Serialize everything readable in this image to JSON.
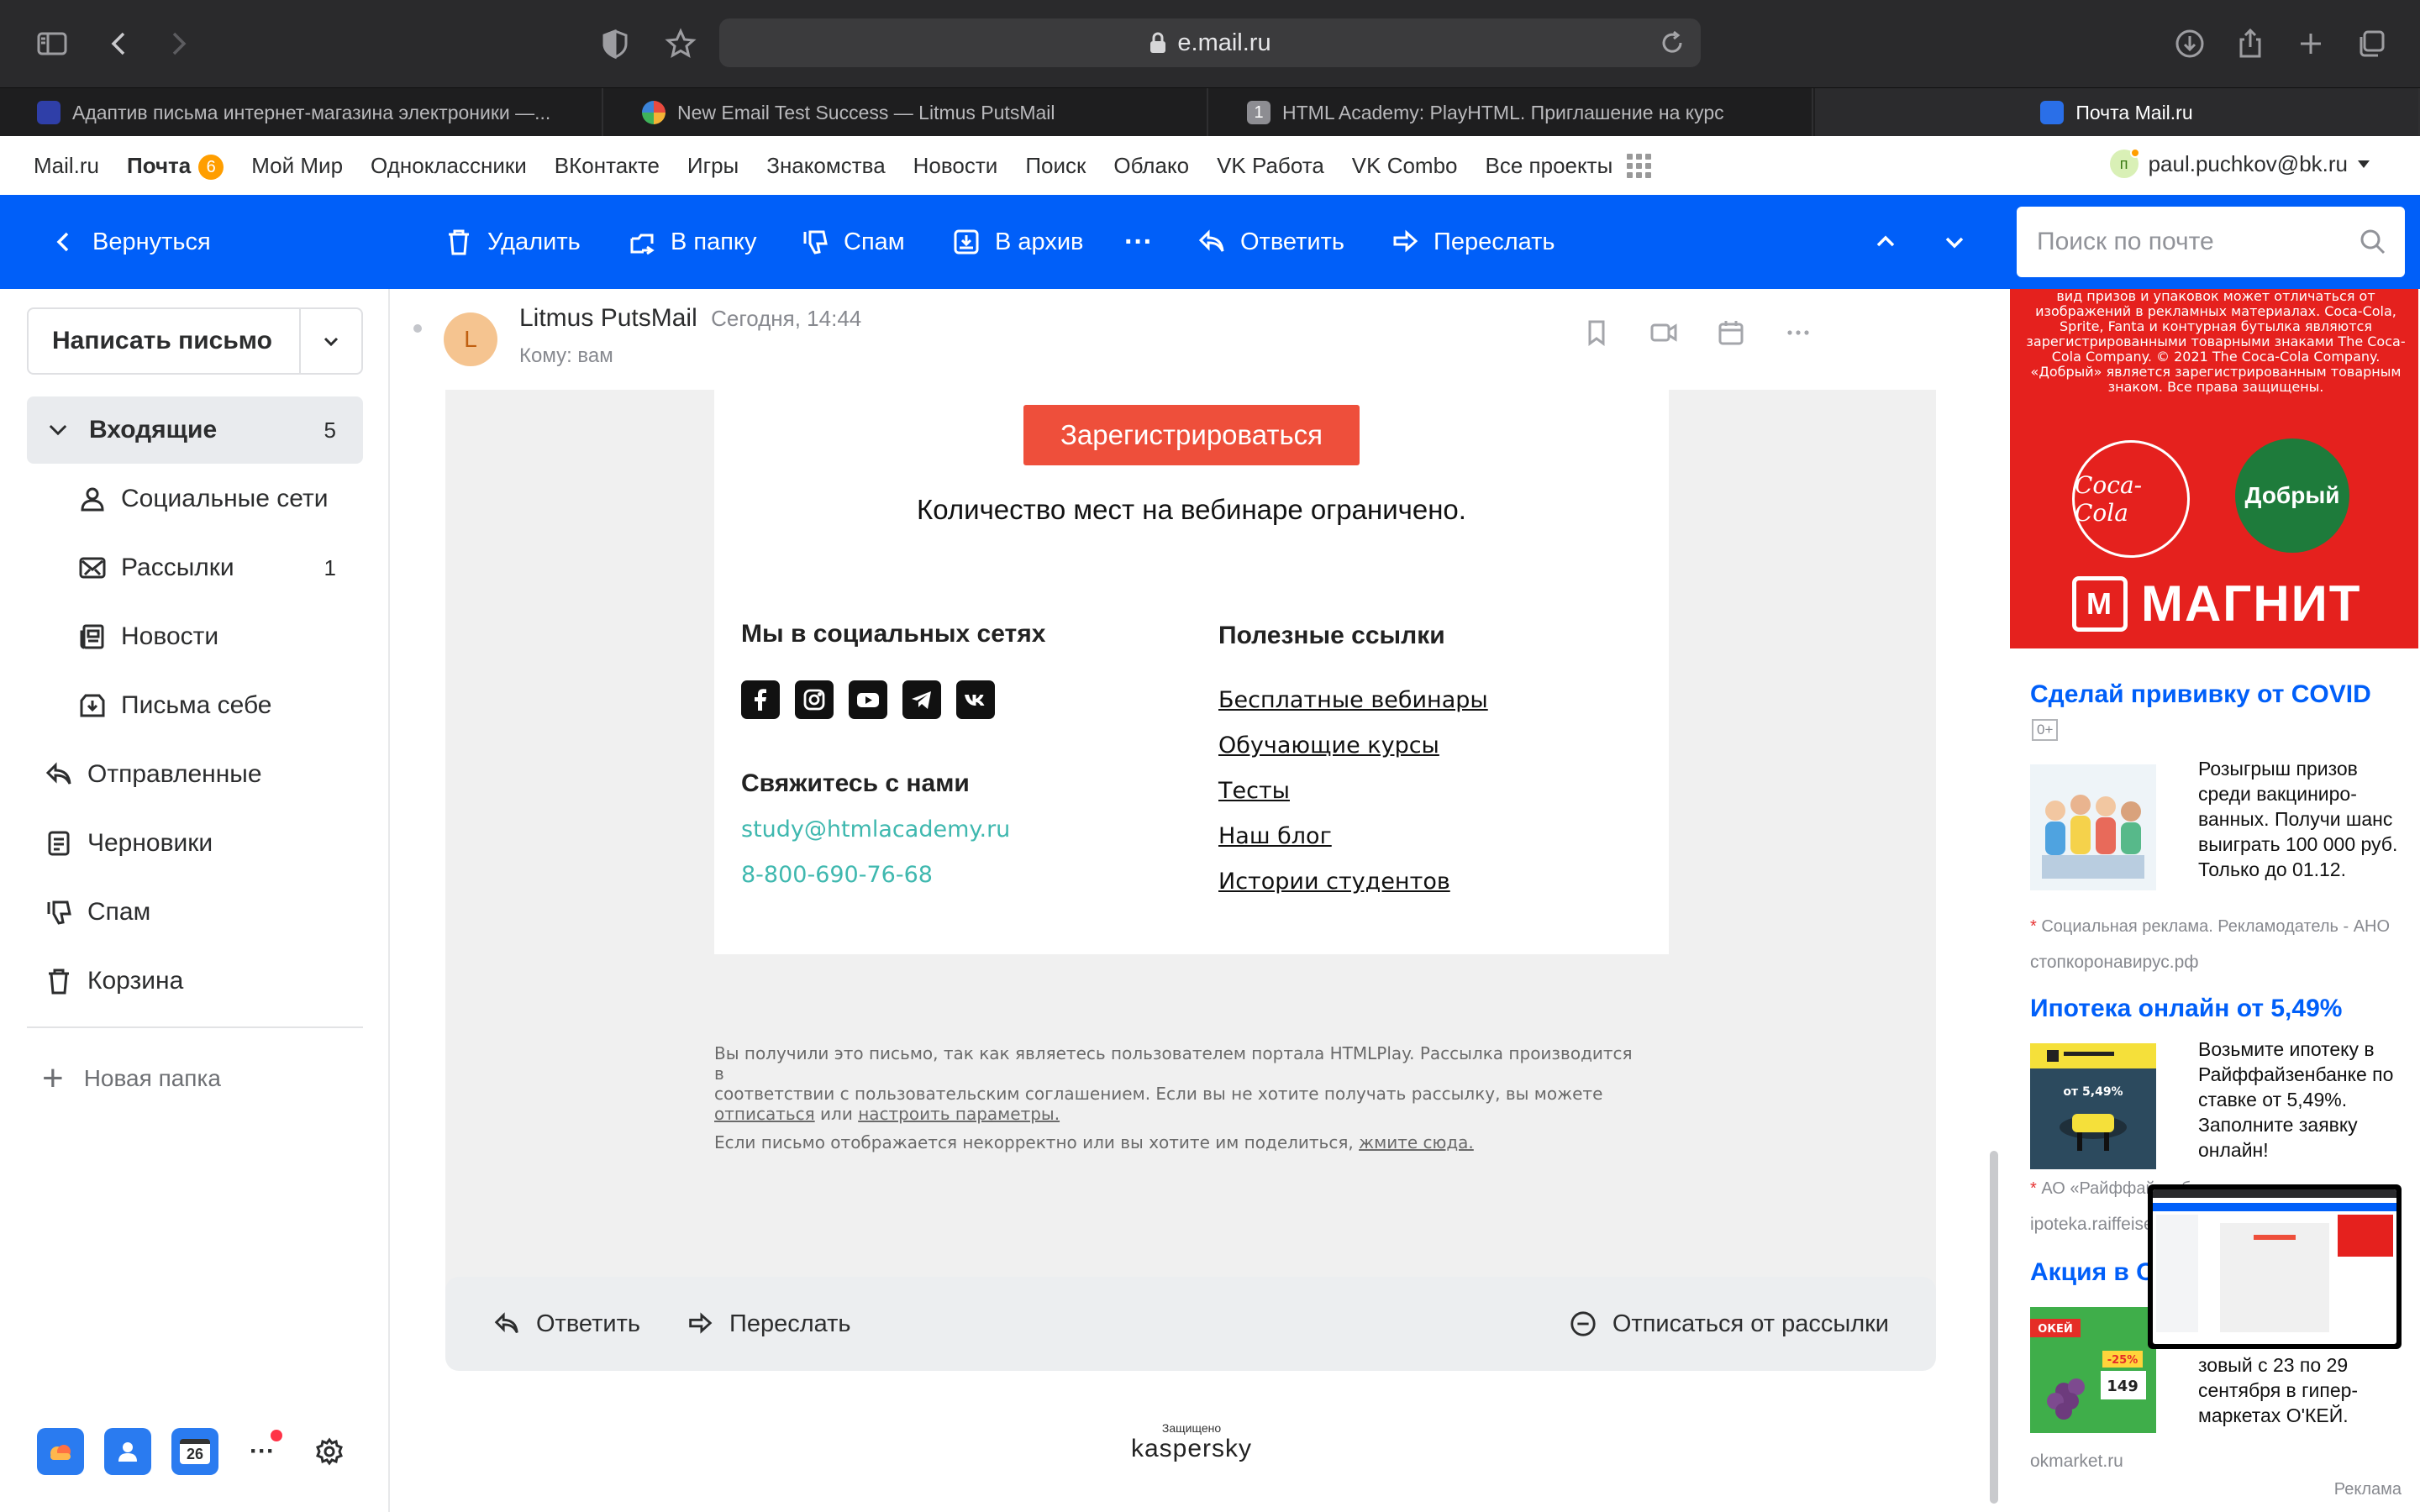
{
  "browser": {
    "url": "e.mail.ru",
    "tabs": [
      {
        "title": "Адаптив письма интернет-магазина электроники —..."
      },
      {
        "title": "New Email Test Success — Litmus PutsMail"
      },
      {
        "title": "HTML Academy: PlayHTML. Приглашение на курс",
        "favicon_text": "1"
      },
      {
        "title": "Почта Mail.ru"
      }
    ]
  },
  "portal": {
    "links": [
      "Mail.ru",
      "Почта",
      "Мой Мир",
      "Одноклассники",
      "ВКонтакте",
      "Игры",
      "Знакомства",
      "Новости",
      "Поиск",
      "Облако",
      "VK Работа",
      "VK Combo",
      "Все проекты"
    ],
    "mail_badge": "6",
    "user_initial": "п",
    "user_email": "paul.puchkov@bk.ru"
  },
  "toolbar": {
    "back": "Вернуться",
    "delete": "Удалить",
    "to_folder": "В папку",
    "spam": "Спам",
    "archive": "В архив",
    "more": "···",
    "reply": "Ответить",
    "forward": "Переслать",
    "search_placeholder": "Поиск по почте"
  },
  "sidebar": {
    "compose": "Написать письмо",
    "folders": [
      {
        "label": "Входящие",
        "count": "5"
      },
      {
        "label": "Социальные сети",
        "count": ""
      },
      {
        "label": "Рассылки",
        "count": "1"
      },
      {
        "label": "Новости",
        "count": ""
      },
      {
        "label": "Письма себе",
        "count": ""
      },
      {
        "label": "Отправленные",
        "count": ""
      },
      {
        "label": "Черновики",
        "count": ""
      },
      {
        "label": "Спам",
        "count": ""
      },
      {
        "label": "Корзина",
        "count": ""
      }
    ],
    "new_folder": "Новая папка",
    "calendar_day": "26",
    "more": "···"
  },
  "message": {
    "avatar_letter": "L",
    "sender": "Litmus PutsMail",
    "time": "Сегодня, 14:44",
    "to": "Кому: вам"
  },
  "email": {
    "register_button": "Зарегистрироваться",
    "seats_text": "Количество мест на вебинаре ограничено.",
    "social_title": "Мы в социальных сетях",
    "social": [
      "facebook",
      "instagram",
      "youtube",
      "telegram",
      "vk"
    ],
    "contact_title": "Свяжитесь с нами",
    "email": "study@htmlacademy.ru",
    "phone": "8-800-690-76-68",
    "links_title": "Полезные ссылки",
    "links": [
      "Бесплатные вебинары",
      "Обучающие курсы",
      "Тесты",
      "Наш блог",
      "Истории студентов"
    ],
    "legal_line1": "Вы получили это письмо, так как являетесь пользователем портала HTMLPlay. Рассылка производится в",
    "legal_line2": "соответствии с пользовательским соглашением. Если вы не хотите получать рассылку, вы можете",
    "legal_unsub": "отписаться",
    "legal_or": " или ",
    "legal_settings": "настроить параметры.",
    "legal_line4": "Если письмо отображается некорректно или вы хотите им поделиться, ",
    "legal_here": "жмите сюда."
  },
  "bottom_actions": {
    "reply": "Ответить",
    "forward": "Переслать",
    "unsubscribe": "Отписаться от рассылки"
  },
  "kaspersky": {
    "protected": "Защищено",
    "brand": "kaspersky"
  },
  "ads": {
    "banner_fine": "вид призов и упаковок может отличаться от изображений в рекламных материалах. Coca-Cola, Sprite, Fanta и контурная бутылка являются зарегистрированными товарными знаками The Coca-Cola Company. © 2021 The Coca-Cola Company. «Добрый» является зарегистрированным товарным знаком. Все права защищены.",
    "coke": "Coca-Cola",
    "dobry": "Добрый",
    "magnit": "МАГНИТ",
    "items": [
      {
        "title": "Сделай прививку от COVID",
        "age": "0+",
        "text": "Розыгрыш призов среди вакциниро-ванных. Получи шанс выиграть 100 000 руб. Только до 01.12.",
        "note": "Социальная реклама. Рекламодатель - АНО",
        "domain": "стопкоронавирус.рф"
      },
      {
        "title": "Ипотека онлайн от 5,49%",
        "text": "Возьмите ипотеку в Райффайзенбанке по ставке от 5,49%. Заполните заявку онлайн!",
        "note": "АО «Райффайзенбанк»",
        "domain": "ipoteka.raiffeisen.ru",
        "img_text": "от 5,49%"
      },
      {
        "title": "Акция в О'КЕЙ",
        "text": "зовый с 23 по 29 сентября в гипер-маркетах О'КЕЙ.",
        "domain": "okmarket.ru",
        "img_brand": "ОКЕЙ",
        "img_sale": "-25%",
        "img_price": "149"
      }
    ],
    "label": "Реклама"
  },
  "colors": {
    "accent": "#005ff9",
    "register": "#ee4f3b",
    "contact": "#3fb8af",
    "ad_red": "#e5211e"
  }
}
